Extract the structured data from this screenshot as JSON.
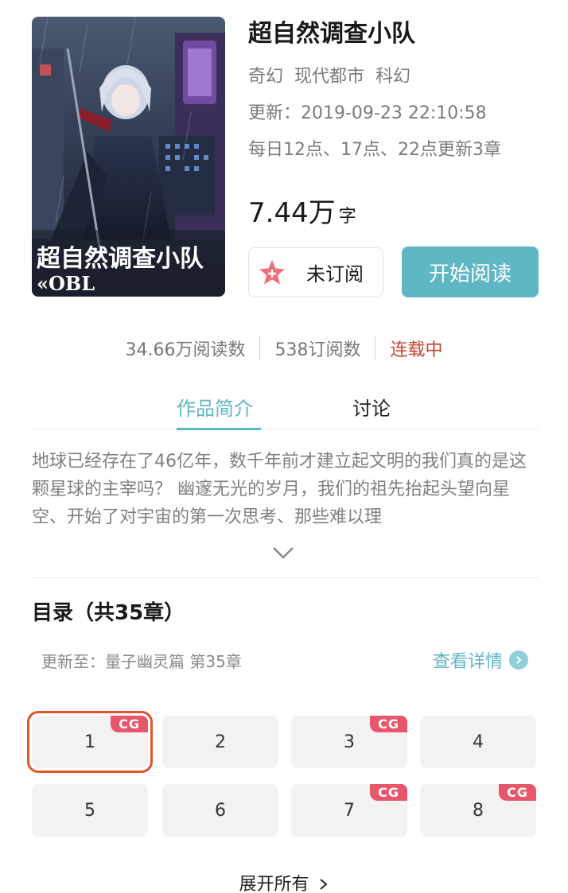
{
  "book": {
    "title": "超自然调查小队",
    "tags": [
      "奇幻",
      "现代都市",
      "科幻"
    ],
    "updated": "更新：2019-09-23 22:10:58",
    "schedule": "每日12点、17点、22点更新3章",
    "word_count": "7.44万",
    "word_unit": "字",
    "cover_text_line1": "超自然调查小队",
    "cover_text_line2": "«OBL"
  },
  "actions": {
    "subscribe_label": "未订阅",
    "read_label": "开始阅读"
  },
  "stats": {
    "reads": "34.66万阅读数",
    "subs": "538订阅数",
    "status": "连载中"
  },
  "tabs": [
    {
      "label": "作品简介",
      "active": true
    },
    {
      "label": "讨论",
      "active": false
    }
  ],
  "description": "地球已经存在了46亿年，数千年前才建立起文明的我们真的是这颗星球的主宰吗？ 幽邃无光的岁月，我们的祖先抬起头望向星空、开始了对宇宙的第一次思考、那些难以理",
  "toc": {
    "title": "目录（共35章）",
    "latest": "更新至：量子幽灵篇 第35章",
    "detail_label": "查看详情",
    "chapters": [
      {
        "num": "1",
        "cg": true,
        "selected": true
      },
      {
        "num": "2",
        "cg": false
      },
      {
        "num": "3",
        "cg": true
      },
      {
        "num": "4",
        "cg": false
      },
      {
        "num": "5",
        "cg": false
      },
      {
        "num": "6",
        "cg": false
      },
      {
        "num": "7",
        "cg": true
      },
      {
        "num": "8",
        "cg": true
      }
    ],
    "cg_label": "CG",
    "expand_label": "展开所有"
  },
  "colors": {
    "accent": "#5fb6c4",
    "status": "#c8422b",
    "cg_badge": "#e8566c",
    "selection": "#e0552b"
  }
}
